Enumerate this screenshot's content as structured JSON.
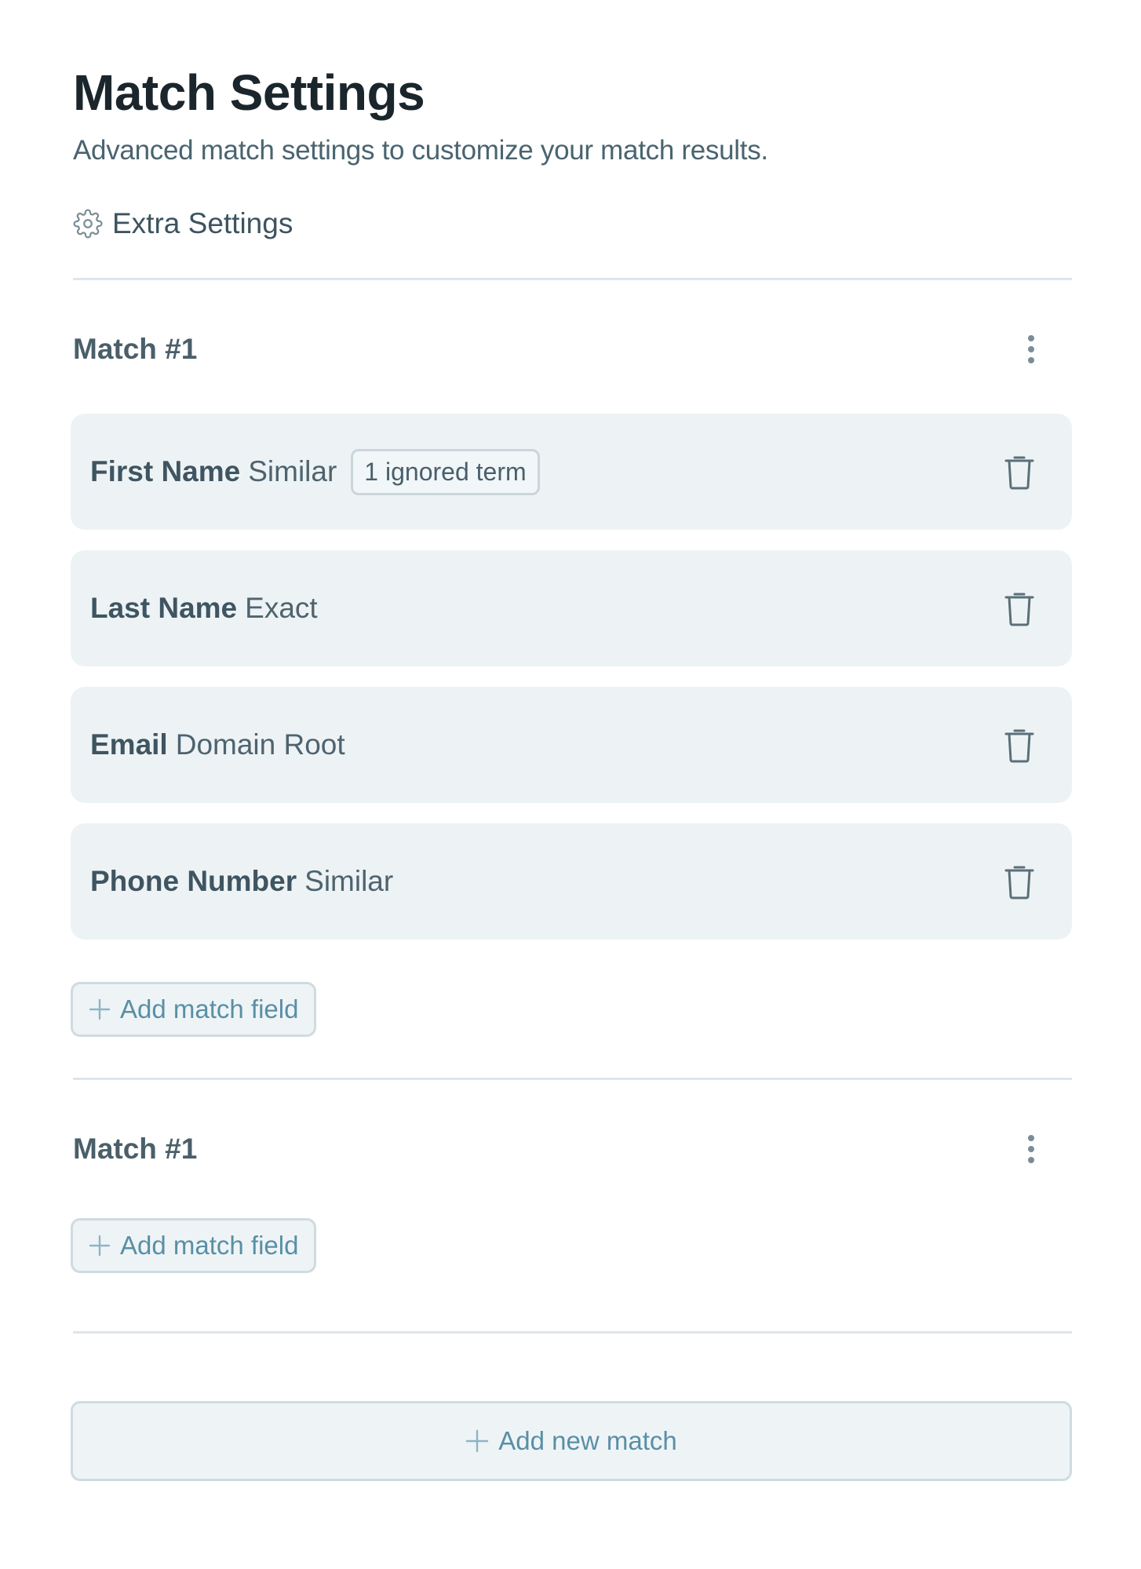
{
  "header": {
    "title": "Match Settings",
    "subtitle": "Advanced match settings to customize your match results."
  },
  "extra_settings": {
    "label": "Extra Settings",
    "icon": "gear-icon"
  },
  "matches": [
    {
      "title": "Match #1",
      "menu_icon": "kebab-menu-icon",
      "fields": [
        {
          "name": "First Name",
          "mode": "Similar",
          "badge": "1 ignored term"
        },
        {
          "name": "Last Name",
          "mode": "Exact"
        },
        {
          "name": "Email",
          "mode": "Domain Root"
        },
        {
          "name": "Phone Number",
          "mode": "Similar"
        }
      ],
      "add_field_label": "Add match field"
    },
    {
      "title": "Match #1",
      "menu_icon": "kebab-menu-icon",
      "fields": [],
      "add_field_label": "Add match field"
    }
  ],
  "add_match_label": "Add new match",
  "colors": {
    "accent": "#5a8fa6",
    "row_background": "#edf3f5",
    "divider": "#dde6ea"
  }
}
